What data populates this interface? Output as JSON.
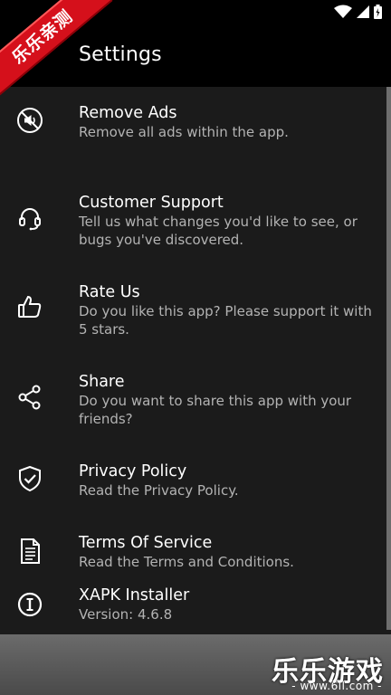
{
  "header": {
    "title": "Settings"
  },
  "watermark": {
    "ribbon": "乐乐亲测",
    "brand": "乐乐游戏",
    "url": "- www.6ll.com -"
  },
  "settings": [
    {
      "title": "Remove Ads",
      "subtitle": "Remove all ads within the app.",
      "icon": "remove-ads-icon"
    },
    {
      "title": "Customer Support",
      "subtitle": "Tell us what changes you'd like to see, or bugs you've discovered.",
      "icon": "headset-icon"
    },
    {
      "title": "Rate Us",
      "subtitle": "Do you like this app? Please support it with 5 stars.",
      "icon": "thumbs-up-icon"
    },
    {
      "title": "Share",
      "subtitle": "Do you want to share this app with your friends?",
      "icon": "share-icon"
    },
    {
      "title": "Privacy Policy",
      "subtitle": "Read the Privacy Policy.",
      "icon": "shield-check-icon"
    },
    {
      "title": "Terms Of Service",
      "subtitle": "Read the Terms and Conditions.",
      "icon": "document-icon"
    },
    {
      "title": "XAPK Installer",
      "subtitle": "Version: 4.6.8",
      "icon": "info-icon"
    }
  ],
  "colors": {
    "background": "#1b1b1b",
    "bar": "#000000",
    "subtitle": "#b3b3b3",
    "ribbon": "#d5101b"
  }
}
